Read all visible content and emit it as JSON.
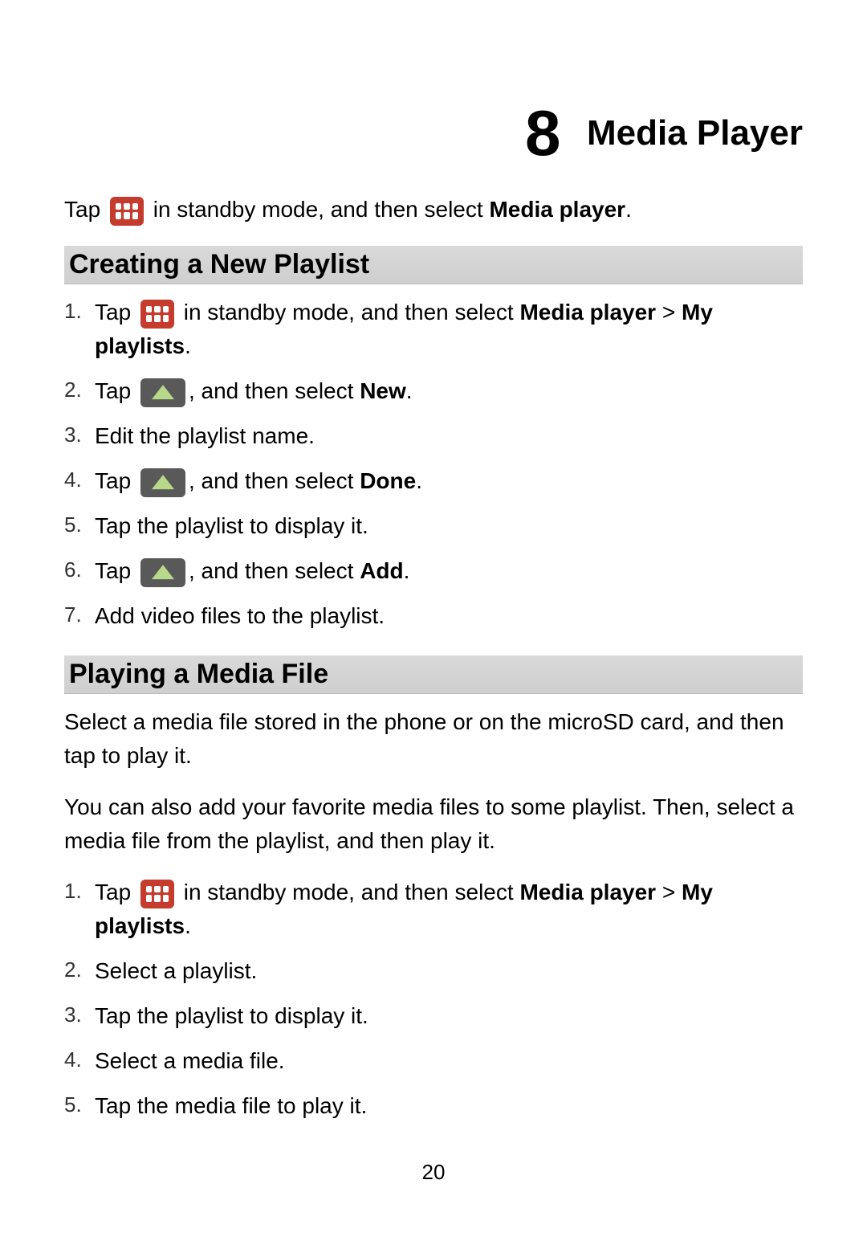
{
  "chapter": {
    "number": "8",
    "title": "Media Player"
  },
  "intro": {
    "before": "Tap ",
    "after": " in standby mode, and then select ",
    "bold1": "Media player",
    "tail": "."
  },
  "section1": {
    "heading": "Creating a New Playlist",
    "steps": [
      {
        "b": "Tap ",
        "a": " in standby mode, and then select ",
        "bold1": "Media player",
        "mid": " > ",
        "bold2": "My playlists",
        "tail": ".",
        "icon": "grid"
      },
      {
        "b": "Tap ",
        "a": ", and then select ",
        "bold1": "New",
        "tail": ".",
        "icon": "triangle"
      },
      {
        "plain": "Edit the playlist name."
      },
      {
        "b": "Tap ",
        "a": ", and then select ",
        "bold1": "Done",
        "tail": ".",
        "icon": "triangle"
      },
      {
        "plain": "Tap the playlist to display it."
      },
      {
        "b": "Tap ",
        "a": ", and then select ",
        "bold1": "Add",
        "tail": ".",
        "icon": "triangle"
      },
      {
        "plain": "Add video files to the playlist."
      }
    ]
  },
  "section2": {
    "heading": "Playing a Media File",
    "para1": "Select a media file stored in the phone or on the microSD card, and then tap to play it.",
    "para2": "You can also add your favorite media files to some playlist. Then, select a media file from the playlist, and then play it.",
    "steps": [
      {
        "b": "Tap ",
        "a": " in standby mode, and then select ",
        "bold1": "Media player",
        "mid": " > ",
        "bold2": "My playlists",
        "tail": ".",
        "icon": "grid"
      },
      {
        "plain": "Select a playlist."
      },
      {
        "plain": "Tap the playlist to display it."
      },
      {
        "plain": "Select a media file."
      },
      {
        "plain": "Tap the media file to play it."
      }
    ]
  },
  "pageNumber": "20"
}
